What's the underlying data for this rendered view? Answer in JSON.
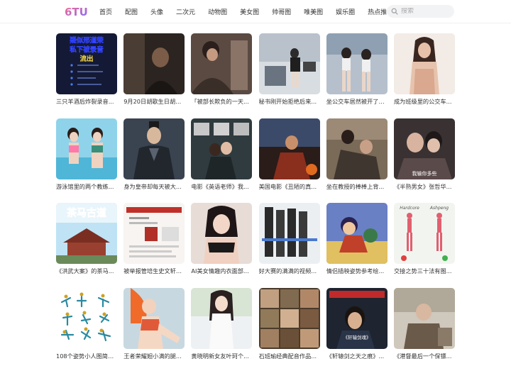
{
  "header": {
    "logo_text": "6TU",
    "nav": [
      "首页",
      "配图",
      "头像",
      "二次元",
      "动物图",
      "美女图",
      "帅哥图",
      "唯美图",
      "娱乐圈",
      "热点推荐"
    ],
    "search_placeholder": "搜索"
  },
  "thumb_overlays": {
    "t0": [
      "疑似邢道荣",
      "私下被录音",
      "流出"
    ],
    "t12": "茶马古道",
    "t16_left": "Hardcore",
    "t16_right": "Ashpeng",
    "t10_sub": "我输你多些",
    "t21_sub": "《轩辕剑魂》"
  },
  "cards": [
    {
      "caption": "三只羊酒后炸裂录音...",
      "color": "#1b1f3a"
    },
    {
      "caption": "9月20日胡歌生日胡歌...",
      "color": "#3a2e28"
    },
    {
      "caption": "「被部长欺负的一天...",
      "color": "#4a3e38"
    },
    {
      "caption": "秘书刚开始拒绝后来...",
      "color": "#c9cdd2"
    },
    {
      "caption": "坐公交车居然被开了2...",
      "color": "#a9b4c0"
    },
    {
      "caption": "成为班级里的公交车...",
      "color": "#efe7e2"
    },
    {
      "caption": "游泳馆里的两个教练...",
      "color": "#7cc7e0"
    },
    {
      "caption": "身为皇帝却每天被大...",
      "color": "#2e3440"
    },
    {
      "caption": "电影《英语老师》我...",
      "color": "#3c4b4f"
    },
    {
      "caption": "美国电影《丑陋的真...",
      "color": "#6b3a2e"
    },
    {
      "caption": "坐在教授的棒棒上背...",
      "color": "#6a5a4a"
    },
    {
      "caption": "《半熟男女》张哲华...",
      "color": "#3a3030"
    },
    {
      "caption": "《洪武大案》的茶马...",
      "color": "#c9e4f2"
    },
    {
      "caption": "被举报管培生史文轩5...",
      "color": "#f5f2ef"
    },
    {
      "caption": "AI美女情趣内衣面部...",
      "color": "#e8dcd6"
    },
    {
      "caption": "好大赛的满满的视频...",
      "color": "#dfe3e6"
    },
    {
      "caption": "情侣插秧姿势参考绘...",
      "color": "#6a7fbf"
    },
    {
      "caption": "交接之势三十法有图...",
      "color": "#f0f3ee"
    },
    {
      "caption": "108个姿势小人图简笔...",
      "color": "#ffffff"
    },
    {
      "caption": "王者荣耀妲小满的腿...",
      "color": "#d9c6b4"
    },
    {
      "caption": "黄晓明新女友叶珂个...",
      "color": "#eef0f2"
    },
    {
      "caption": "石班瑜经典配音作品...",
      "color": "#8a6a4a"
    },
    {
      "caption": "《轩辕剑之天之痕》...",
      "color": "#2a2f3a"
    },
    {
      "caption": "《港督最后一个保镖...",
      "color": "#c8c2b8"
    }
  ]
}
